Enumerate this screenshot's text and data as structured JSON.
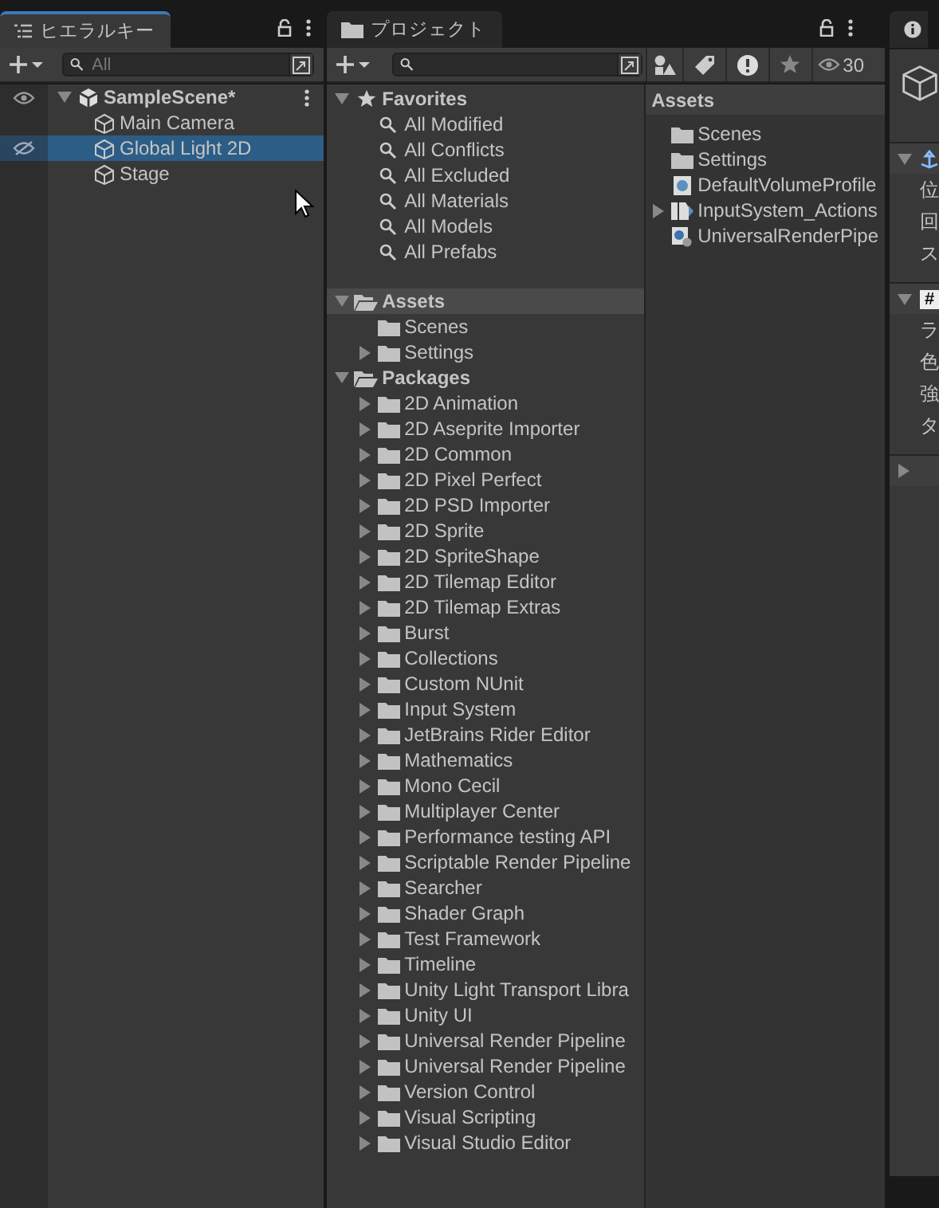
{
  "hierarchy": {
    "tab": {
      "title": "ヒエラルキー",
      "selected": true
    },
    "search": {
      "placeholder": "All"
    },
    "scene": {
      "name": "SampleScene*",
      "expanded": true,
      "children": [
        {
          "name": "Main Camera",
          "selected": false,
          "hidden": false
        },
        {
          "name": "Global Light 2D",
          "selected": true,
          "hidden": true
        },
        {
          "name": "Stage",
          "selected": false,
          "hidden": false
        }
      ]
    }
  },
  "project": {
    "tab": {
      "title": "プロジェクト",
      "selected": false
    },
    "visible_count": "30",
    "favorites": {
      "label": "Favorites",
      "expanded": true,
      "items": [
        "All Modified",
        "All Conflicts",
        "All Excluded",
        "All Materials",
        "All Models",
        "All Prefabs"
      ]
    },
    "tree": [
      {
        "name": "Assets",
        "expanded": true,
        "selected": true,
        "children": [
          {
            "name": "Scenes",
            "expandable": false
          },
          {
            "name": "Settings",
            "expandable": true
          }
        ]
      },
      {
        "name": "Packages",
        "expanded": true,
        "selected": false,
        "children": [
          {
            "name": "2D Animation",
            "expandable": true
          },
          {
            "name": "2D Aseprite Importer",
            "expandable": true
          },
          {
            "name": "2D Common",
            "expandable": true
          },
          {
            "name": "2D Pixel Perfect",
            "expandable": true
          },
          {
            "name": "2D PSD Importer",
            "expandable": true
          },
          {
            "name": "2D Sprite",
            "expandable": true
          },
          {
            "name": "2D SpriteShape",
            "expandable": true
          },
          {
            "name": "2D Tilemap Editor",
            "expandable": true
          },
          {
            "name": "2D Tilemap Extras",
            "expandable": true
          },
          {
            "name": "Burst",
            "expandable": true
          },
          {
            "name": "Collections",
            "expandable": true
          },
          {
            "name": "Custom NUnit",
            "expandable": true
          },
          {
            "name": "Input System",
            "expandable": true
          },
          {
            "name": "JetBrains Rider Editor",
            "expandable": true
          },
          {
            "name": "Mathematics",
            "expandable": true
          },
          {
            "name": "Mono Cecil",
            "expandable": true
          },
          {
            "name": "Multiplayer Center",
            "expandable": true
          },
          {
            "name": "Performance testing API",
            "expandable": true
          },
          {
            "name": "Scriptable Render Pipeline",
            "expandable": true
          },
          {
            "name": "Searcher",
            "expandable": true
          },
          {
            "name": "Shader Graph",
            "expandable": true
          },
          {
            "name": "Test Framework",
            "expandable": true
          },
          {
            "name": "Timeline",
            "expandable": true
          },
          {
            "name": "Unity Light Transport Libra",
            "expandable": true
          },
          {
            "name": "Unity UI",
            "expandable": true
          },
          {
            "name": "Universal Render Pipeline",
            "expandable": true
          },
          {
            "name": "Universal Render Pipeline",
            "expandable": true
          },
          {
            "name": "Version Control",
            "expandable": true
          },
          {
            "name": "Visual Scripting",
            "expandable": true
          },
          {
            "name": "Visual Studio Editor",
            "expandable": true
          }
        ]
      }
    ],
    "assets": {
      "title": "Assets",
      "items": [
        {
          "name": "Scenes",
          "kind": "folder",
          "expandable": false
        },
        {
          "name": "Settings",
          "kind": "folder",
          "expandable": false
        },
        {
          "name": "DefaultVolumeProfile",
          "kind": "profile",
          "expandable": false
        },
        {
          "name": "InputSystem_Actions",
          "kind": "actions",
          "expandable": true
        },
        {
          "name": "UniversalRenderPipe",
          "kind": "pipeline",
          "expandable": false
        }
      ]
    }
  },
  "inspector": {
    "sections": [
      {
        "expanded": true,
        "kind": "transform",
        "fields": [
          "位",
          "回",
          "ス"
        ]
      },
      {
        "expanded": true,
        "kind": "tagged",
        "badge": "#",
        "fields": [
          "ラ",
          "色",
          "強",
          "タ"
        ]
      },
      {
        "expanded": false,
        "kind": "empty"
      }
    ]
  }
}
